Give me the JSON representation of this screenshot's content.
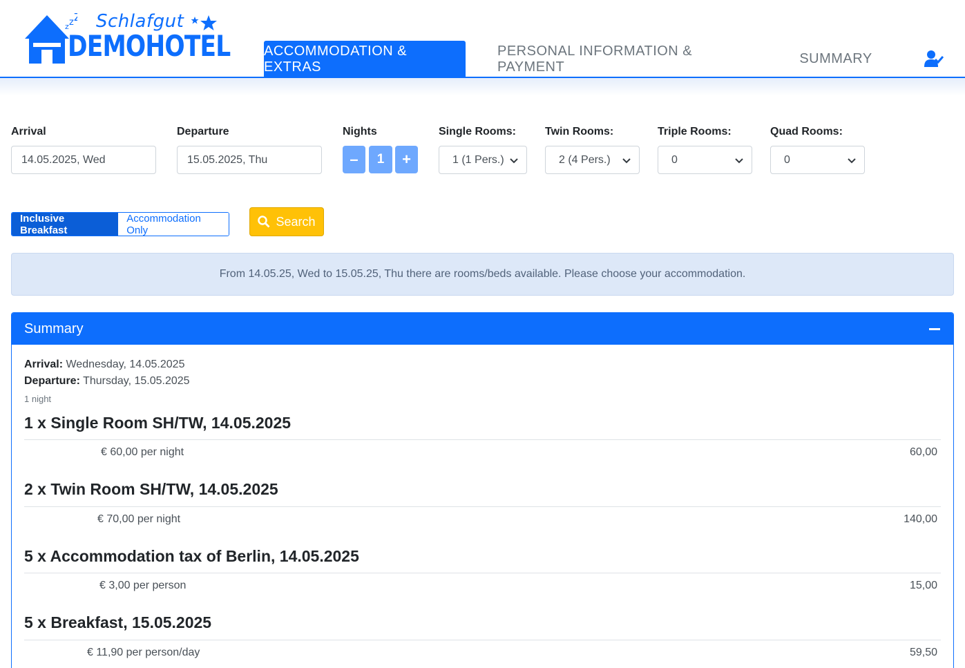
{
  "brand": {
    "script": "Schlafgut",
    "name": "DEMOHOTEL"
  },
  "nav": {
    "tab1": "ACCOMMODATION & EXTRAS",
    "tab2": "PERSONAL INFORMATION & PAYMENT",
    "tab3": "SUMMARY"
  },
  "form": {
    "arrival_label": "Arrival",
    "arrival_value": "14.05.2025, Wed",
    "departure_label": "Departure",
    "departure_value": "15.05.2025, Thu",
    "nights_label": "Nights",
    "nights_value": "1",
    "minus": "–",
    "plus": "+",
    "single_label": "Single Rooms:",
    "single_value": "1 (1 Pers.)",
    "twin_label": "Twin Rooms:",
    "twin_value": "2 (4 Pers.)",
    "triple_label": "Triple Rooms:",
    "triple_value": "0",
    "quad_label": "Quad Rooms:",
    "quad_value": "0",
    "breakfast_on": "Inclusive Breakfast",
    "breakfast_off": "Accommodation Only",
    "search": "Search"
  },
  "alert": "From 14.05.25, Wed to 15.05.25, Thu there are rooms/beds available. Please choose your accommodation.",
  "summary": {
    "title": "Summary",
    "arrival_label": "Arrival:",
    "arrival_value": "Wednesday, 14.05.2025",
    "departure_label": "Departure:",
    "departure_value": "Thursday, 15.05.2025",
    "nights": "1 night",
    "items": [
      {
        "title": "1 x Single Room SH/TW, 14.05.2025",
        "price": "€ 60,00 per night",
        "total": "60,00"
      },
      {
        "title": "2 x Twin Room SH/TW, 14.05.2025",
        "price": "€ 70,00 per night",
        "total": "140,00"
      },
      {
        "title": "5 x Accommodation tax of Berlin, 14.05.2025",
        "price": "€ 3,00 per person",
        "total": "15,00"
      },
      {
        "title": "5 x Breakfast, 15.05.2025",
        "price": "€ 11,90 per person/day",
        "total": "59,50"
      }
    ]
  }
}
